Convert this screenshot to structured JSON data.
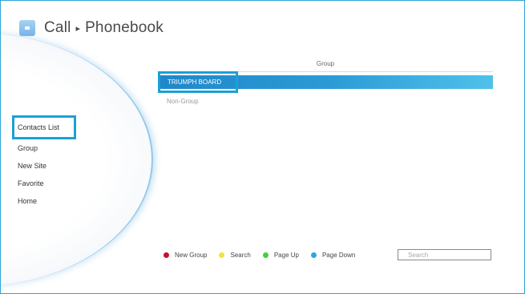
{
  "header": {
    "icon": "home-icon",
    "title_primary": "Call",
    "separator": "▸",
    "title_secondary": "Phonebook"
  },
  "sidebar": {
    "items": [
      {
        "label": "Contacts List",
        "selected": true
      },
      {
        "label": "Group",
        "selected": false
      },
      {
        "label": "New Site",
        "selected": false
      },
      {
        "label": "Favorite",
        "selected": false
      },
      {
        "label": "Home",
        "selected": false
      }
    ]
  },
  "group_list": {
    "header": "Group",
    "rows": [
      {
        "label": "TRIUMPH BOARD",
        "selected": true
      },
      {
        "label": "Non-Group",
        "selected": false
      }
    ]
  },
  "legend": {
    "items": [
      {
        "label": "New Group",
        "color": "#c8102e"
      },
      {
        "label": "Search",
        "color": "#f2e538"
      },
      {
        "label": "Page Up",
        "color": "#3fd140"
      },
      {
        "label": "Page Down",
        "color": "#2aa7e3"
      }
    ]
  },
  "search": {
    "placeholder": "Search",
    "value": ""
  },
  "colors": {
    "accent": "#1ba0d8",
    "selected_row": "#2a9ad6",
    "border": "#2fa4d6"
  }
}
